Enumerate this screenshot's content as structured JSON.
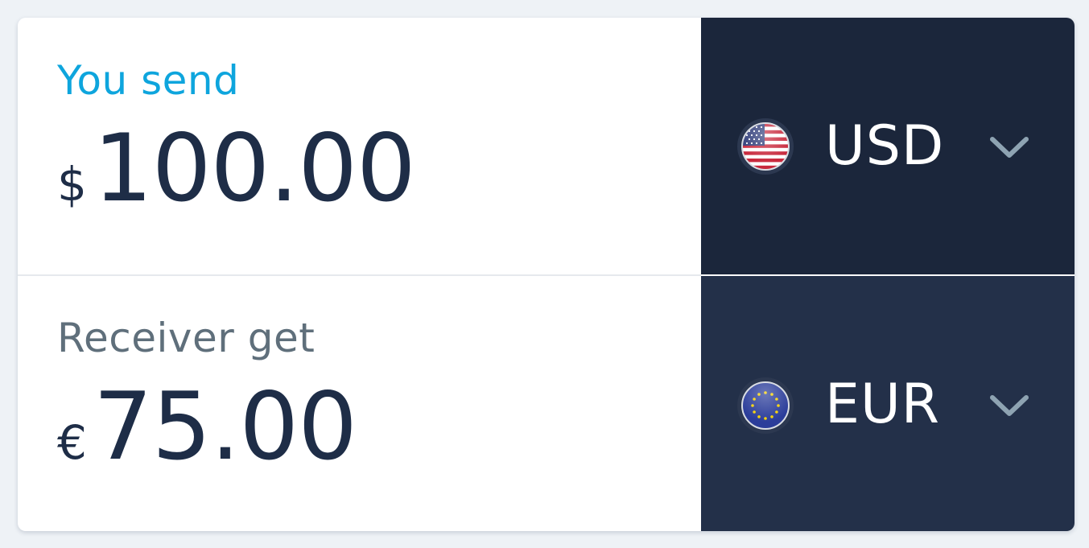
{
  "send": {
    "label": "You send",
    "symbol": "$",
    "amount": "100.00",
    "currency_code": "USD",
    "flag_icon": "us-flag-icon"
  },
  "receive": {
    "label": "Receiver get",
    "symbol": "€",
    "amount": "75.00",
    "currency_code": "EUR",
    "flag_icon": "eu-flag-icon"
  },
  "colors": {
    "send_label": "#0ea5dd",
    "receive_label": "#5f6f7b",
    "amount_text": "#1e2d47",
    "send_currency_bg": "#1b263b",
    "receive_currency_bg": "#233049",
    "chevron": "#8ea3b2"
  }
}
